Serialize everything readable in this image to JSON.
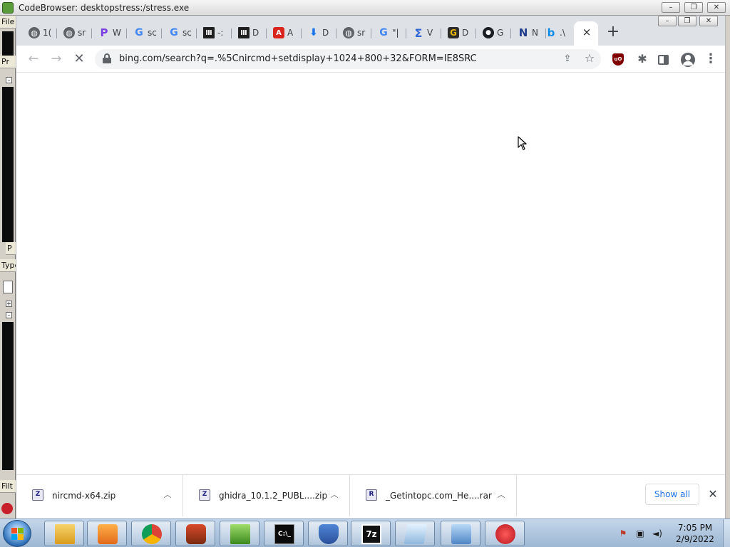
{
  "background_window": {
    "title": "CodeBrowser: desktopstress:/stress.exe",
    "side_labels": [
      "File",
      "Pr",
      "P",
      "Type",
      "Filt"
    ]
  },
  "browser": {
    "tabs": [
      {
        "favicon": "globe-icon",
        "title": "1("
      },
      {
        "favicon": "globe-icon",
        "title": "sr"
      },
      {
        "favicon": "p-logo-icon",
        "title": "W"
      },
      {
        "favicon": "google-icon",
        "title": "sc"
      },
      {
        "favicon": "google-icon",
        "title": "sc"
      },
      {
        "favicon": "archive-icon",
        "title": "-:"
      },
      {
        "favicon": "archive-icon",
        "title": "D"
      },
      {
        "favicon": "adobe-icon",
        "title": "A"
      },
      {
        "favicon": "download-icon",
        "title": "D"
      },
      {
        "favicon": "globe-icon",
        "title": "sr"
      },
      {
        "favicon": "google-icon",
        "title": "\"|"
      },
      {
        "favicon": "sigma-icon",
        "title": "V"
      },
      {
        "favicon": "g-logo-icon",
        "title": "D"
      },
      {
        "favicon": "github-icon",
        "title": "G"
      },
      {
        "favicon": "n-logo-icon",
        "title": "N"
      },
      {
        "favicon": "bing-icon",
        "title": ".\\"
      }
    ],
    "active_tab_close": "×",
    "new_tab": "+",
    "url": "bing.com/search?q=.%5Cnircmd+setdisplay+1024+800+32&FORM=IE8SRC",
    "downloads": [
      {
        "name": "nircmd-x64.zip",
        "type_icon": "Z"
      },
      {
        "name": "ghidra_10.1.2_PUBL....zip",
        "type_icon": "Z"
      },
      {
        "name": "_Getintopc.com_He....rar",
        "type_icon": "R"
      }
    ],
    "show_all": "Show all",
    "shelf_close": "✕"
  },
  "taskbar": {
    "apps": [
      {
        "name": "explorer-icon",
        "label": ""
      },
      {
        "name": "media-player-icon",
        "label": ""
      },
      {
        "name": "chrome-icon",
        "label": ""
      },
      {
        "name": "ghidra-dragon-icon",
        "label": ""
      },
      {
        "name": "notepadpp-icon",
        "label": ""
      },
      {
        "name": "cmd-icon",
        "label": "C:\\_"
      },
      {
        "name": "shield-app-icon",
        "label": ""
      },
      {
        "name": "7zip-icon",
        "label": "7z"
      },
      {
        "name": "notepad-icon",
        "label": ""
      },
      {
        "name": "control-panel-icon",
        "label": ""
      },
      {
        "name": "ghidra-red-icon",
        "label": ""
      }
    ],
    "time": "7:05 PM",
    "date": "2/9/2022"
  },
  "colors": {
    "chrome_tabstrip": "#dee1e6",
    "link_blue": "#1a73e8",
    "taskbar_top": "#c4d6ea"
  }
}
